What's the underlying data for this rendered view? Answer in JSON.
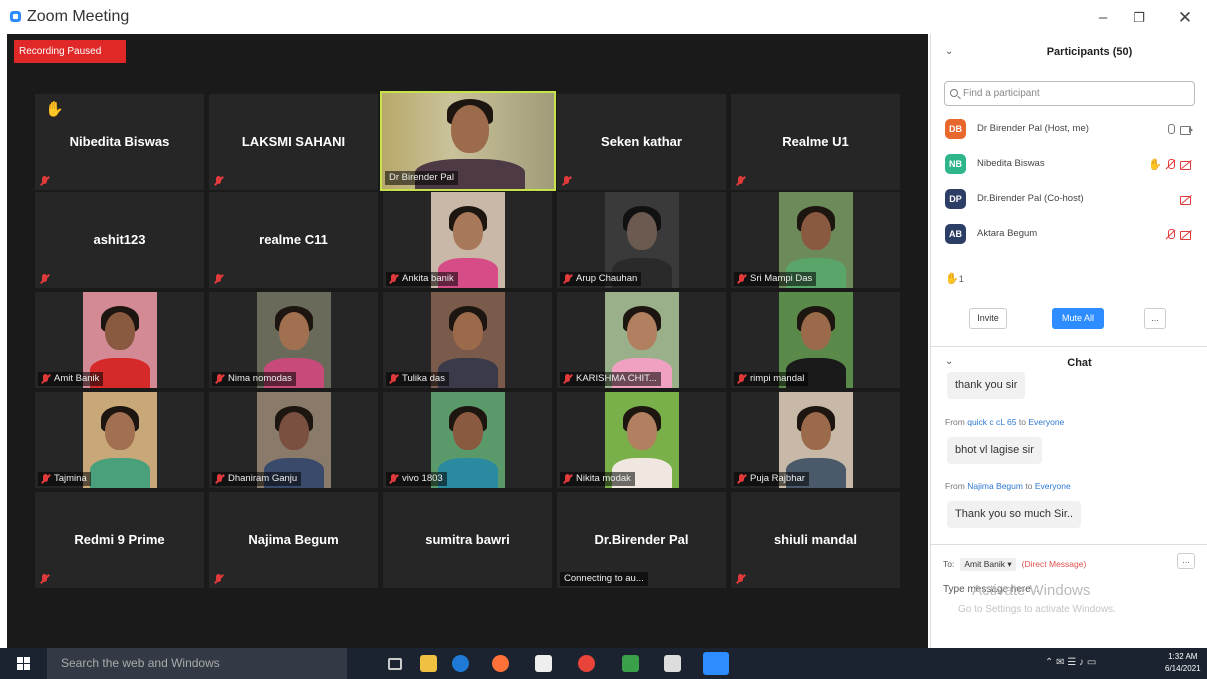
{
  "window": {
    "title": "Zoom Meeting"
  },
  "recording": {
    "status": "Recording Paused"
  },
  "tiles": [
    {
      "name": "Nibedita Biswas",
      "hand": true
    },
    {
      "name": "LAKSMI SAHANI"
    },
    {
      "name": "Dr Birender Pal",
      "video": true,
      "active": true
    },
    {
      "name": "Seken kathar"
    },
    {
      "name": "Realme U1"
    },
    {
      "name": "ashit123"
    },
    {
      "name": "realme C11"
    },
    {
      "name": "Ankita banik",
      "video": true
    },
    {
      "name": "Arup Chauhan",
      "video": true
    },
    {
      "name": "Sri Mampi Das",
      "video": true
    },
    {
      "name": "Amit Banik",
      "video": true
    },
    {
      "name": "Nima nomodas",
      "video": true
    },
    {
      "name": "Tulika das",
      "video": true
    },
    {
      "name": "KARISHMA CHIT...",
      "video": true
    },
    {
      "name": "rimpi mandal",
      "video": true
    },
    {
      "name": "Tajmina",
      "video": true
    },
    {
      "name": "Dhaniram Ganju",
      "video": true
    },
    {
      "name": "vivo 1803",
      "video": true
    },
    {
      "name": "Nikita modak",
      "video": true
    },
    {
      "name": "Puja Rajbhar",
      "video": true
    },
    {
      "name": "Redmi 9 Prime"
    },
    {
      "name": "Najima Begum"
    },
    {
      "name": "sumitra bawri"
    },
    {
      "name": "Dr.Birender Pal",
      "status": "Connecting to au..."
    },
    {
      "name": "shiuli mandal"
    }
  ],
  "participants_panel": {
    "title": "Participants (50)",
    "search_placeholder": "Find a participant",
    "participants": [
      {
        "initials": "DB",
        "name": "Dr Birender Pal (Host, me)",
        "color": "#e8672c"
      },
      {
        "initials": "NB",
        "name": "Nibedita Biswas",
        "color": "#2fb58b"
      },
      {
        "initials": "DP",
        "name": "Dr.Birender Pal (Co-host)",
        "color": "#2c3e66"
      },
      {
        "initials": "AB",
        "name": "Aktara Begum",
        "color": "#2c3e66"
      }
    ],
    "raised_hands": "1",
    "invite_label": "Invite",
    "mute_all_label": "Mute All",
    "more_label": "..."
  },
  "chat": {
    "title": "Chat",
    "messages": [
      {
        "text": "thank you sir"
      },
      {
        "from": "quick c cL 65",
        "to": "Everyone",
        "text": "bhot vl lagise sir"
      },
      {
        "from": "Najima Begum",
        "to": "Everyone",
        "text": "Thank you so much Sir.."
      }
    ],
    "from_word": "From",
    "to_word": "to",
    "to_label": "To:",
    "recipient": "Amit Banik",
    "direct_message": "(Direct Message)",
    "compose_placeholder": "Type message here...",
    "more_label": "..."
  },
  "watermark": {
    "line1": "Activate Windows",
    "line2": "Go to Settings to activate Windows."
  },
  "taskbar": {
    "search_placeholder": "Search the web and Windows",
    "time": "1:32 AM",
    "date": "6/14/2021"
  },
  "colors": {
    "accent": "#2d8cff",
    "recording": "#e02828",
    "active_speaker": "#c7e24b",
    "muted": "#e03a3a"
  }
}
